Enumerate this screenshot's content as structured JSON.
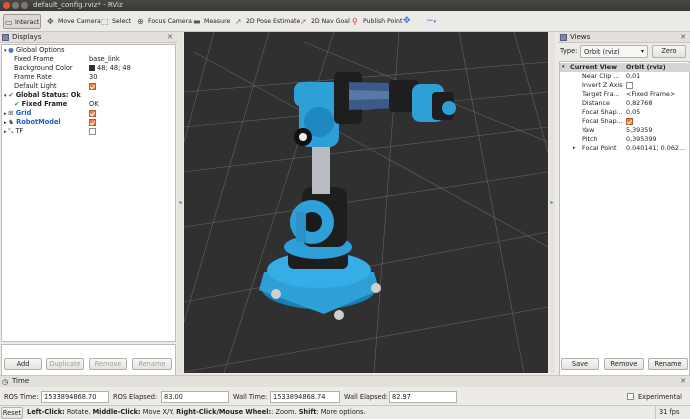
{
  "window": {
    "title": "default_config.rviz* - RViz"
  },
  "toolbar": {
    "interact": "Interact",
    "move_camera": "Move Camera",
    "select": "Select",
    "focus_camera": "Focus Camera",
    "measure": "Measure",
    "pose_estimate": "2D Pose Estimate",
    "nav_goal": "2D Nav Goal",
    "publish_point": "Publish Point",
    "add_icon": "✥",
    "remove_icon": "−"
  },
  "displays": {
    "title": "Displays",
    "rows": [
      {
        "indent": 0,
        "arrow": "▾",
        "icon": "gear",
        "label": "Global Options",
        "value": ""
      },
      {
        "indent": 1,
        "arrow": "",
        "icon": "",
        "label": "Fixed Frame",
        "value": "base_link"
      },
      {
        "indent": 1,
        "arrow": "",
        "icon": "",
        "label": "Background Color",
        "value": "48; 48; 48",
        "swatch": true
      },
      {
        "indent": 1,
        "arrow": "",
        "icon": "",
        "label": "Frame Rate",
        "value": "30"
      },
      {
        "indent": 1,
        "arrow": "",
        "icon": "",
        "label": "Default Light",
        "value": "",
        "check": true
      },
      {
        "indent": 0,
        "arrow": "▾",
        "icon": "ok",
        "label": "Global Status: Ok",
        "value": ""
      },
      {
        "indent": 1,
        "arrow": "",
        "icon": "ok",
        "label": "Fixed Frame",
        "value": "OK"
      },
      {
        "indent": 0,
        "arrow": "▸",
        "icon": "grid",
        "label": "Grid",
        "value": "",
        "check": true,
        "blue": true
      },
      {
        "indent": 0,
        "arrow": "▸",
        "icon": "robot",
        "label": "RobotModel",
        "value": "",
        "check": true,
        "blue": true
      },
      {
        "indent": 0,
        "arrow": "▸",
        "icon": "tf",
        "label": "TF",
        "value": "",
        "check": false
      }
    ],
    "buttons": {
      "add": "Add",
      "duplicate": "Duplicate",
      "remove": "Remove",
      "rename": "Rename"
    }
  },
  "views": {
    "title": "Views",
    "type_label": "Type:",
    "type_value": "Orbit (rviz)",
    "zero": "Zero",
    "header_name": "Current View",
    "header_value": "Orbit (rviz)",
    "rows": [
      {
        "arrow": "",
        "label": "Near Clip ...",
        "value": "0,01"
      },
      {
        "arrow": "",
        "label": "Invert Z Axis",
        "value": "",
        "check": false
      },
      {
        "arrow": "",
        "label": "Target Fra...",
        "value": "<Fixed Frame>"
      },
      {
        "arrow": "",
        "label": "Distance",
        "value": "0,82768"
      },
      {
        "arrow": "",
        "label": "Focal Shap...",
        "value": "0,05"
      },
      {
        "arrow": "",
        "label": "Focal Shap...",
        "value": "",
        "check": true
      },
      {
        "arrow": "",
        "label": "Yaw",
        "value": "5,39359"
      },
      {
        "arrow": "",
        "label": "Pitch",
        "value": "0,395399"
      },
      {
        "arrow": "▸",
        "label": "Focal Point",
        "value": "0.040141; 0.062..."
      }
    ],
    "buttons": {
      "save": "Save",
      "remove": "Remove",
      "rename": "Rename"
    }
  },
  "time": {
    "title": "Time",
    "ros_time_label": "ROS Time:",
    "ros_time": "1533894868.70",
    "ros_elapsed_label": "ROS Elapsed:",
    "ros_elapsed": "83.00",
    "wall_time_label": "Wall Time:",
    "wall_time": "1533894868.74",
    "wall_elapsed_label": "Wall Elapsed:",
    "wall_elapsed": "82.97",
    "experimental": "Experimental"
  },
  "status": {
    "reset": "Reset",
    "hint_b1": "Left-Click:",
    "hint_t1": " Rotate. ",
    "hint_b2": "Middle-Click:",
    "hint_t2": " Move X/Y. ",
    "hint_b3": "Right-Click/Mouse Wheel:",
    "hint_t3": ": Zoom. ",
    "hint_b4": "Shift",
    "hint_t4": ": More options.",
    "fps": "31 fps"
  },
  "colors": {
    "robot_blue": "#2f9fd8",
    "robot_dark": "#1e1e1e",
    "background": "#303030"
  }
}
